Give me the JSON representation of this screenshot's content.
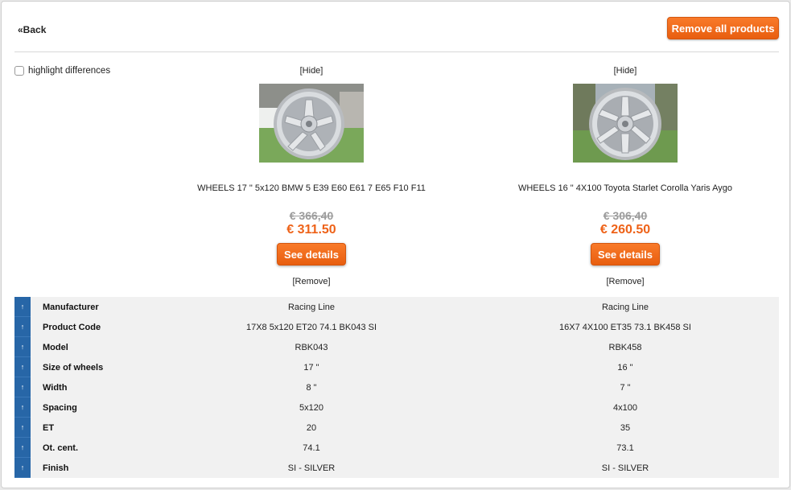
{
  "nav": {
    "back_label": "«Back",
    "remove_all_label": "Remove all products"
  },
  "options": {
    "highlight_label": "highlight differences"
  },
  "products": [
    {
      "hide_label": "[Hide]",
      "name": "WHEELS 17 \" 5x120 BMW 5 E39 E60 E61 7 E65 F10 F11",
      "old_price": "€ 366,40",
      "new_price": "€ 311.50",
      "details_label": "See details",
      "remove_label": "[Remove]"
    },
    {
      "hide_label": "[Hide]",
      "name": "WHEELS 16 \" 4X100 Toyota Starlet Corolla Yaris Aygo",
      "old_price": "€ 306,40",
      "new_price": "€ 260.50",
      "details_label": "See details",
      "remove_label": "[Remove]"
    }
  ],
  "specs": [
    {
      "label": "Manufacturer",
      "values": [
        "Racing Line",
        "Racing Line"
      ]
    },
    {
      "label": "Product Code",
      "values": [
        "17X8 5x120 ET20 74.1 BK043 SI",
        "16X7 4X100 ET35 73.1 BK458 SI"
      ]
    },
    {
      "label": "Model",
      "values": [
        "RBK043",
        "RBK458"
      ]
    },
    {
      "label": "Size of wheels",
      "values": [
        "17 \"",
        "16 \""
      ]
    },
    {
      "label": "Width",
      "values": [
        "8 \"",
        "7 \""
      ]
    },
    {
      "label": "Spacing",
      "values": [
        "5x120",
        "4x100"
      ]
    },
    {
      "label": "ET",
      "values": [
        "20",
        "35"
      ]
    },
    {
      "label": "Ot. cent.",
      "values": [
        "74.1",
        "73.1"
      ]
    },
    {
      "label": "Finish",
      "values": [
        "SI - SILVER",
        "SI - SILVER"
      ]
    }
  ],
  "arrow_glyph": "↑",
  "colors": {
    "accent": "#ee6218",
    "row_arrow": "#2766a7",
    "old_price": "#9c9c9c"
  }
}
